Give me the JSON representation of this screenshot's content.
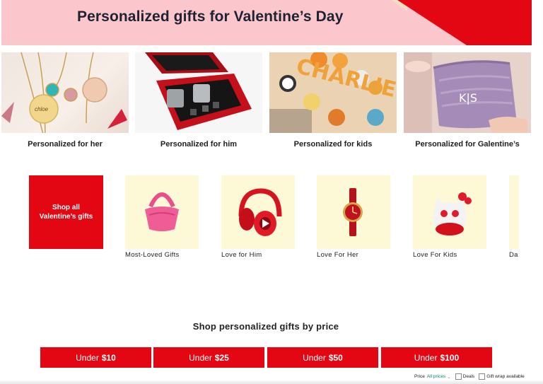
{
  "banner": {
    "title": "Personalized gifts for Valentine’s Day"
  },
  "tiles": [
    {
      "label": "Personalized for her"
    },
    {
      "label": "Personalized for him"
    },
    {
      "label": "Personalized for kids",
      "name_letters": "CHARLIE"
    },
    {
      "label": "Personalized for Galentine’s",
      "monogram": "K|S"
    }
  ],
  "shop_all": {
    "label": "Shop all Valentine’s gifts"
  },
  "categories": [
    {
      "label": "Most-Loved Gifts"
    },
    {
      "label": "Love for Him"
    },
    {
      "label": "Love For Her"
    },
    {
      "label": "Love For Kids"
    },
    {
      "label": "Da"
    }
  ],
  "price_section": {
    "heading": "Shop personalized gifts by price",
    "buttons": [
      {
        "prefix": "Under",
        "amount": "$10"
      },
      {
        "prefix": "Under",
        "amount": "$25"
      },
      {
        "prefix": "Under",
        "amount": "$50"
      },
      {
        "prefix": "Under",
        "amount": "$100"
      }
    ]
  },
  "filters": {
    "price_label": "Price",
    "price_value": "All prices",
    "deals_label": "Deals",
    "giftwrap_label": "Gift wrap available"
  },
  "colors": {
    "brand_red": "#e30613",
    "banner_pink": "#fbc6cc",
    "category_bg": "#fdf8d6"
  }
}
